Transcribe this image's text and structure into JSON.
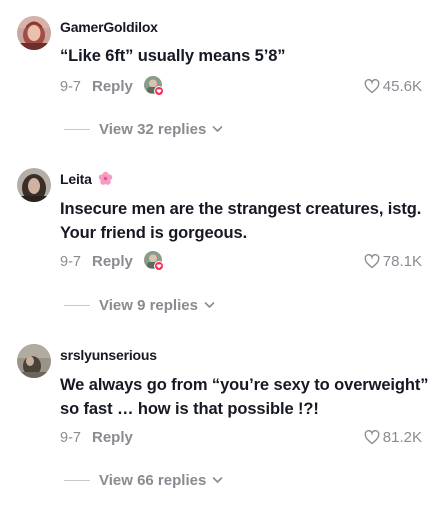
{
  "comments": [
    {
      "username": "GamerGoldilox",
      "has_flower": false,
      "text": "“Like 6ft” usually means 5’8”",
      "date": "9-7",
      "reply_label": "Reply",
      "likes": "45.6K",
      "view_replies": "View 32 replies",
      "creator_liked": true
    },
    {
      "username": "Leita",
      "has_flower": true,
      "text": "Insecure men are the strangest creatures, istg. Your friend is gorgeous.",
      "date": "9-7",
      "reply_label": "Reply",
      "likes": "78.1K",
      "view_replies": "View 9 replies",
      "creator_liked": true
    },
    {
      "username": "srslyunserious",
      "has_flower": false,
      "text": "We always go from “you’re sexy to overweight” so fast … how is that possible !?!",
      "date": "9-7",
      "reply_label": "Reply",
      "likes": "81.2K",
      "view_replies": "View 66 replies",
      "creator_liked": false
    }
  ],
  "colors": {
    "text_primary": "#161823",
    "text_secondary": "#8a8b91",
    "liked_badge": "#fe2c55",
    "flower": "#f59bc4"
  }
}
